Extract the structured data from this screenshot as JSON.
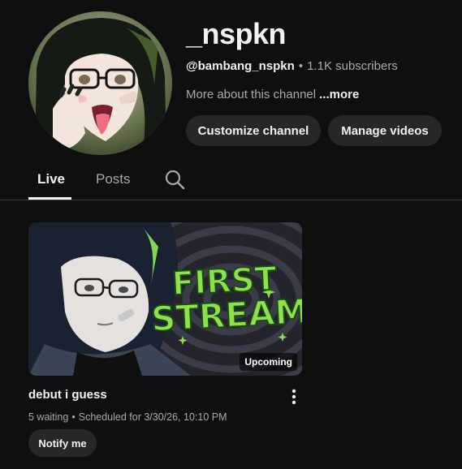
{
  "channel": {
    "name": "_nspkn",
    "handle": "@bambang_nspkn",
    "separator": "•",
    "subscribers": "1.1K subscribers",
    "about": "More about this channel",
    "more_label": "...more",
    "avatar_icon": "channel-avatar-anime-portrait"
  },
  "actions": {
    "customize_label": "Customize channel",
    "manage_label": "Manage videos"
  },
  "tabs": [
    {
      "label": "Live",
      "selected": true
    },
    {
      "label": "Posts",
      "selected": false
    }
  ],
  "tab_search_icon": "search-icon",
  "video": {
    "thumbnail_text_line1": "FIRST",
    "thumbnail_text_line2": "STREAM",
    "badge": "Upcoming",
    "title": "debut i guess",
    "waiting": "5 waiting",
    "separator": "•",
    "scheduled": "Scheduled for 3/30/26, 10:10 PM",
    "notify_label": "Notify me",
    "menu_icon": "more-vert-icon"
  },
  "colors": {
    "background": "#0f0f0f",
    "pill": "#272727",
    "text_primary": "#f1f1f1",
    "text_secondary": "#aaaaaa",
    "thumbnail_accent": "#8fe04a"
  }
}
